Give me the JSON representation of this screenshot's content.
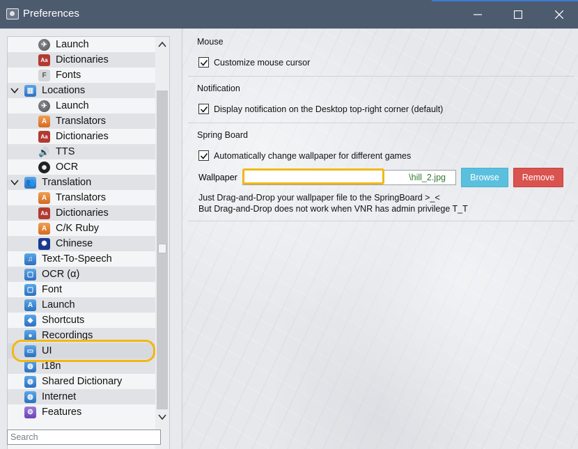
{
  "window": {
    "title": "Preferences"
  },
  "sidebar": {
    "items": [
      {
        "label": "Launch",
        "indent": 2,
        "icon": "rocket-icon",
        "style": "gray",
        "glyph": "✈"
      },
      {
        "label": "Dictionaries",
        "indent": 2,
        "icon": "dictionary-book-icon",
        "style": "red",
        "glyph": "Aa"
      },
      {
        "label": "Fonts",
        "indent": 2,
        "icon": "fonts-icon",
        "style": "paper",
        "glyph": "F"
      },
      {
        "label": "Locations",
        "indent": 1,
        "icon": "library-building-icon",
        "style": "blue",
        "glyph": "▥",
        "expanded": true
      },
      {
        "label": "Launch",
        "indent": 2,
        "icon": "rocket-icon",
        "style": "gray",
        "glyph": "✈"
      },
      {
        "label": "Translators",
        "indent": 2,
        "icon": "translator-icon",
        "style": "orange",
        "glyph": "A"
      },
      {
        "label": "Dictionaries",
        "indent": 2,
        "icon": "dictionary-book-icon",
        "style": "red",
        "glyph": "Aa"
      },
      {
        "label": "TTS",
        "indent": 2,
        "icon": "speaker-icon",
        "style": "speaker",
        "glyph": "🔊"
      },
      {
        "label": "OCR",
        "indent": 2,
        "icon": "ocr-disc-icon",
        "style": "dark",
        "glyph": ""
      },
      {
        "label": "Translation",
        "indent": 1,
        "icon": "people-icon",
        "style": "blue",
        "glyph": "👥",
        "expanded": true
      },
      {
        "label": "Translators",
        "indent": 2,
        "icon": "translator-icon",
        "style": "orange",
        "glyph": "A"
      },
      {
        "label": "Dictionaries",
        "indent": 2,
        "icon": "dictionary-book-icon",
        "style": "red",
        "glyph": "Aa"
      },
      {
        "label": "C/K Ruby",
        "indent": 2,
        "icon": "translator-icon",
        "style": "orange",
        "glyph": "A"
      },
      {
        "label": "Chinese",
        "indent": 2,
        "icon": "sun-flag-icon",
        "style": "navy",
        "glyph": "✺"
      },
      {
        "label": "Text-To-Speech",
        "indent": 1,
        "icon": "music-note-icon",
        "style": "blue",
        "glyph": "♫"
      },
      {
        "label": "OCR (α)",
        "indent": 1,
        "icon": "document-icon",
        "style": "blue",
        "glyph": "▢"
      },
      {
        "label": "Font",
        "indent": 1,
        "icon": "font-file-icon",
        "style": "blue",
        "glyph": "▢"
      },
      {
        "label": "Launch",
        "indent": 1,
        "icon": "launch-a-icon",
        "style": "blue",
        "glyph": "A"
      },
      {
        "label": "Shortcuts",
        "indent": 1,
        "icon": "shortcuts-icon",
        "style": "blue",
        "glyph": "◆"
      },
      {
        "label": "Recordings",
        "indent": 1,
        "icon": "recordings-icon",
        "style": "blue",
        "glyph": "●"
      },
      {
        "label": "UI",
        "indent": 1,
        "icon": "window-ui-icon",
        "style": "blue",
        "glyph": "▭",
        "selected": true
      },
      {
        "label": "i18n",
        "indent": 1,
        "icon": "globe-icon",
        "style": "blue",
        "glyph": "◍"
      },
      {
        "label": "Shared Dictionary",
        "indent": 1,
        "icon": "shared-globe-icon",
        "style": "blue",
        "glyph": "◍"
      },
      {
        "label": "Internet",
        "indent": 1,
        "icon": "internet-globe-icon",
        "style": "blue",
        "glyph": "◍"
      },
      {
        "label": "Features",
        "indent": 1,
        "icon": "gear-icon",
        "style": "purple",
        "glyph": "⚙"
      }
    ],
    "search_placeholder": "Search"
  },
  "main": {
    "mouse": {
      "title": "Mouse",
      "customize_cursor": {
        "label": "Customize mouse cursor",
        "checked": true
      }
    },
    "notification": {
      "title": "Notification",
      "display_notification": {
        "label": "Display notification on the Desktop top-right corner (default)",
        "checked": true
      }
    },
    "springboard": {
      "title": "Spring Board",
      "auto_wallpaper": {
        "label": "Automatically change wallpaper for different games",
        "checked": true
      },
      "wallpaper_label": "Wallpaper",
      "wallpaper_value": "\\hill_2.jpg",
      "browse_label": "Browse",
      "remove_label": "Remove",
      "hint_line1": "Just Drag-and-Drop your wallpaper file to the SpringBoard >_<",
      "hint_line2": "But Drag-and-Drop does not work when VNR has admin privilege T_T"
    }
  },
  "colors": {
    "titlebar": "#4d5b6f",
    "browse": "#5bc0de",
    "remove": "#d9534f",
    "highlight": "#f3b713"
  }
}
